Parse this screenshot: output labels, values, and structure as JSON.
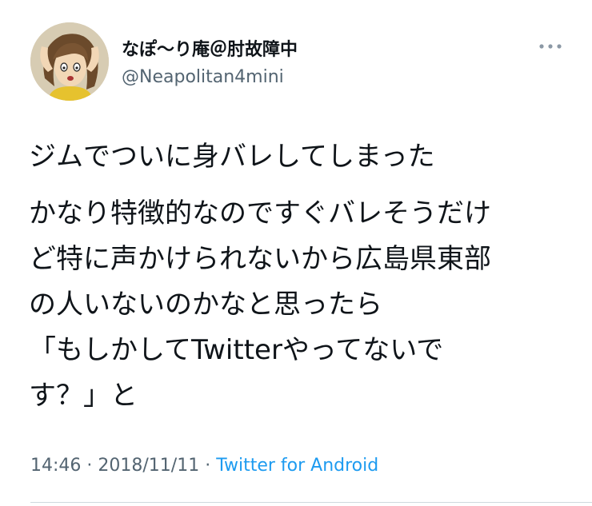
{
  "author": {
    "display_name": "なぽ〜り庵＠肘故障中",
    "username": "@Neapolitan4mini",
    "avatar": "cartoon-woman-avatar"
  },
  "more_icon": "more-dots-icon",
  "tweet": {
    "paragraph_1": "ジムでついに身バレしてしまった",
    "paragraph_2": "かなり特徴的なのですぐバレそうだけ\nど特に声かけられないから広島県東部\nの人いないのかなと思ったら\n「もしかしてTwitterやってないで\nす？」と"
  },
  "meta": {
    "time": "14:46",
    "separator_1": " · ",
    "date": "2018/11/11",
    "separator_2": " · ",
    "source": "Twitter for Android"
  },
  "colors": {
    "text": "#0f1419",
    "secondary": "#536471",
    "link": "#1d9bf0",
    "divider": "#cfd9de"
  }
}
